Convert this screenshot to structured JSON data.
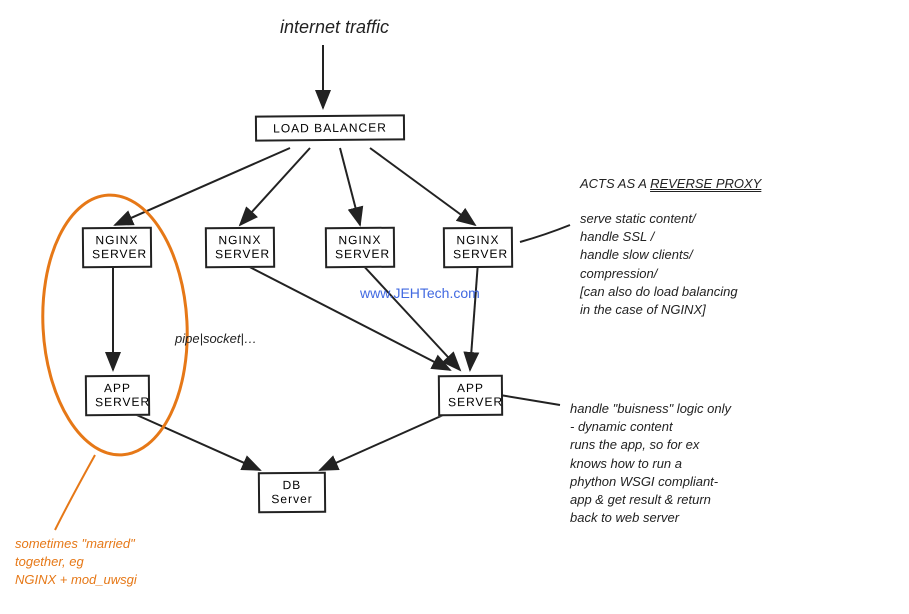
{
  "title": "internet traffic",
  "nodes": {
    "load_balancer": "LOAD BALANCER",
    "nginx1": "NGINX\nSERVER",
    "nginx2": "NGINX\nSERVER",
    "nginx3": "NGINX\nSERVER",
    "nginx4": "NGINX\nSERVER",
    "app1": "APP\nSERVER",
    "app2": "APP\nSERVER",
    "db": "DB\nServer"
  },
  "edge_label": "pipe|socket|…",
  "annotations": {
    "reverse_proxy_title": "ACTS AS A REVERSE PROXY",
    "reverse_proxy_body": "serve static content/\nhandle SSL /\nhandle slow clients/\ncompression/\n[can also do load balancing\nin the case of NGINX]",
    "app_body": "handle \"buisness\" logic only\n- dynamic content\nruns the app, so for ex\nknows how to run a\nphython WSGI compliant-\napp & get result & return\nback to web server",
    "married": "sometimes \"married\"\ntogether, eg\nNGINX + mod_uwsgi"
  },
  "watermark": "www.JEHTech.com"
}
